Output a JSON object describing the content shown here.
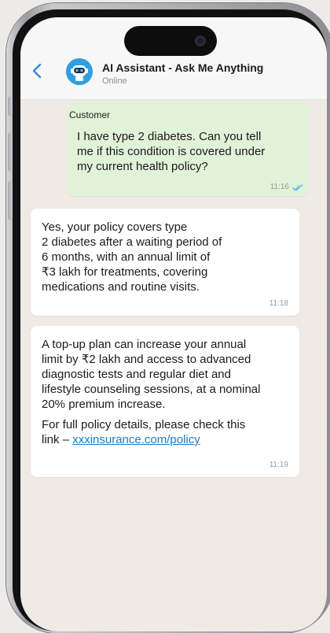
{
  "header": {
    "title": "AI Assistant - Ask Me Anything",
    "status": "Online",
    "back_icon": "chevron-left-icon",
    "avatar_icon": "robot-icon"
  },
  "messages": [
    {
      "direction": "outgoing",
      "sender": "Customer",
      "lines": [
        "I have type 2 diabetes. Can you tell",
        "me if this condition is covered under",
        "my current health policy?"
      ],
      "time": "11:16",
      "receipt_icon": "double-check-icon"
    },
    {
      "direction": "incoming",
      "lines": [
        "Yes, your policy covers type",
        "2 diabetes after a waiting period of",
        "6 months, with an annual limit of",
        "₹3 lakh for treatments, covering",
        "medications and routine visits."
      ],
      "time": "11:18"
    },
    {
      "direction": "incoming",
      "lines": [
        "A top-up plan can increase your annual",
        "limit by ₹2 lakh and access to advanced",
        "diagnostic tests and regular diet and",
        "lifestyle counseling sessions, at a nominal",
        "20% premium increase."
      ],
      "lines2": [
        "For full policy details, please check this"
      ],
      "link_prefix": "link – ",
      "link_text": "xxxinsurance.com/policy",
      "time": "11:19"
    }
  ],
  "colors": {
    "outgoing_bubble": "#e0f2d8",
    "incoming_bubble": "#ffffff",
    "chat_background": "#efeae4",
    "link": "#1e7bc4",
    "read_receipt": "#4fb6ec"
  }
}
